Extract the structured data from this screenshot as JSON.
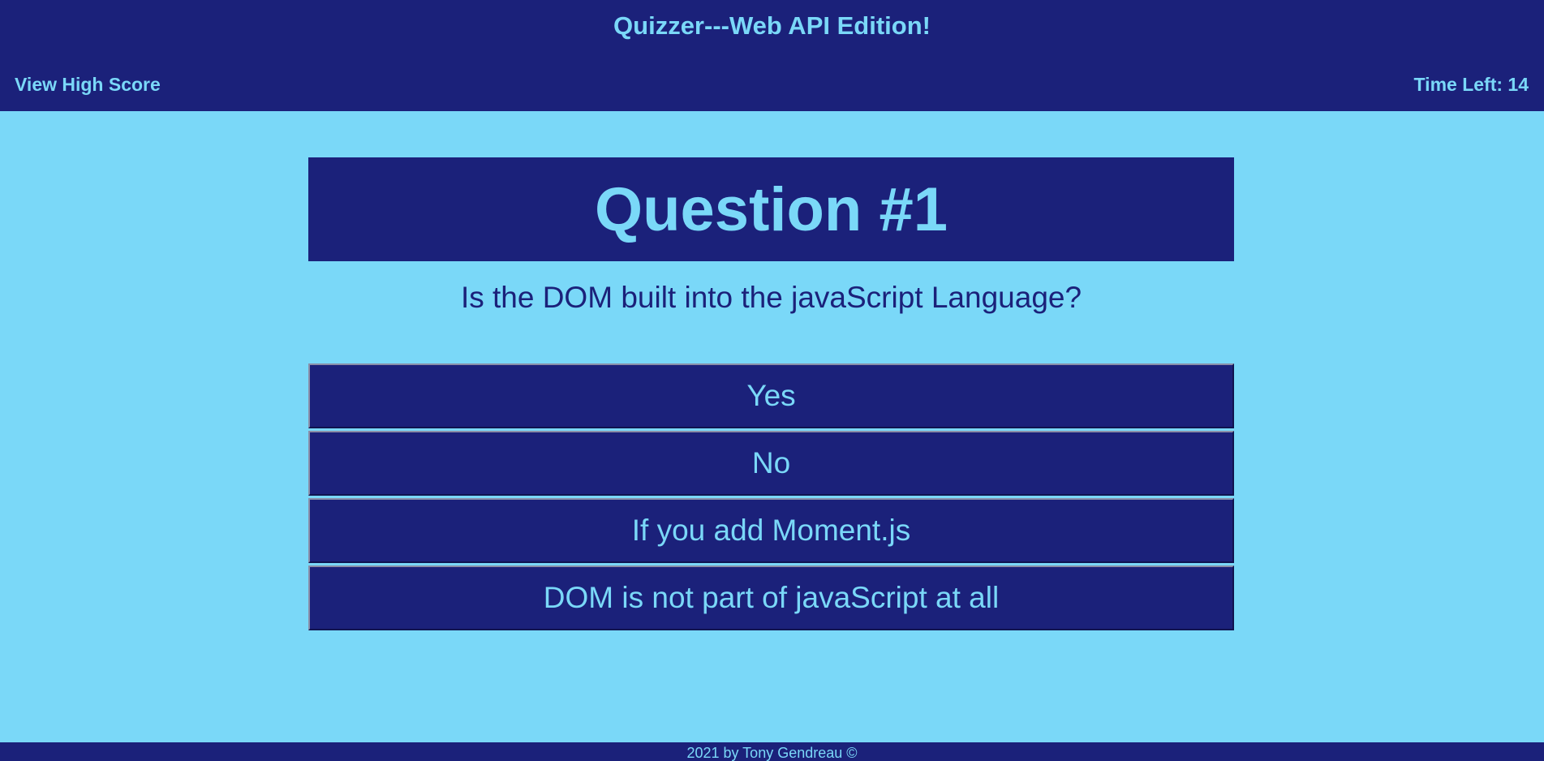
{
  "header": {
    "title": "Quizzer---Web API Edition!",
    "high_score_label": "View High Score",
    "timer_label": "Time Left: 14"
  },
  "quiz": {
    "heading": "Question #1",
    "question": "Is the DOM built into the javaScript Language?",
    "answers": [
      "Yes",
      "No",
      "If you add Moment.js",
      "DOM is not part of javaScript at all"
    ]
  },
  "footer": {
    "text": "2021 by Tony Gendreau ©"
  },
  "colors": {
    "background": "#7ad8f8",
    "primary": "#1b217a"
  }
}
